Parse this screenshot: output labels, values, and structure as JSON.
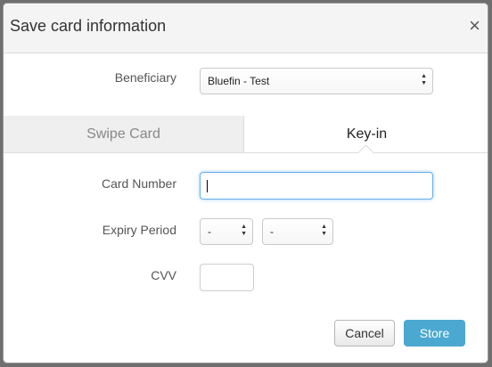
{
  "modal": {
    "title": "Save card information",
    "close_symbol": "×"
  },
  "beneficiary": {
    "label": "Beneficiary",
    "selected": "Bluefin - Test"
  },
  "tabs": [
    {
      "label": "Swipe Card",
      "active": false
    },
    {
      "label": "Key-in",
      "active": true
    }
  ],
  "card_number": {
    "label": "Card Number",
    "value": ""
  },
  "expiry": {
    "label": "Expiry Period",
    "month_selected": "-",
    "year_selected": "-"
  },
  "cvv": {
    "label": "CVV",
    "value": ""
  },
  "buttons": {
    "cancel": "Cancel",
    "store": "Store"
  },
  "colors": {
    "accent": "#4ba8d0",
    "focus": "#66afe9"
  }
}
